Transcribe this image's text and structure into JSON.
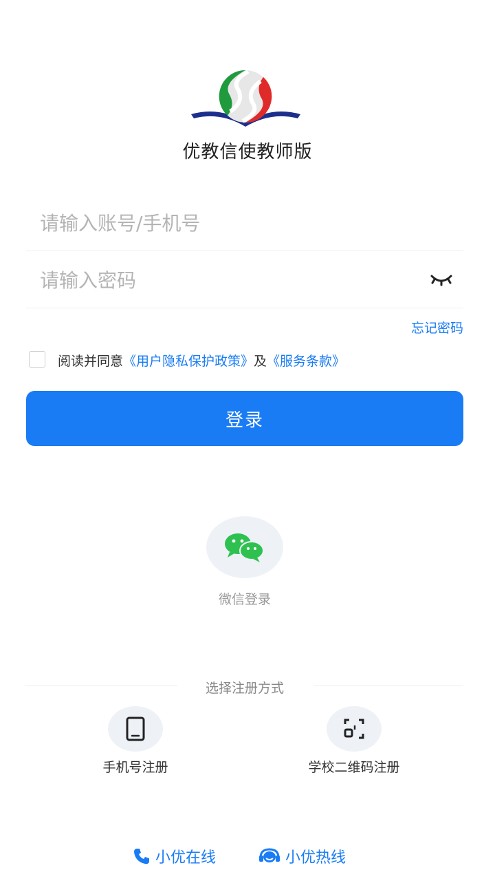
{
  "app": {
    "title": "优教信使教师版"
  },
  "login": {
    "account_placeholder": "请输入账号/手机号",
    "password_placeholder": "请输入密码",
    "forgot_password": "忘记密码",
    "agree_prefix": "阅读并同意",
    "privacy_link": "《用户隐私保护政策》",
    "agree_and": "及",
    "terms_link": "《服务条款》",
    "submit_label": "登录",
    "agreement_checked": false
  },
  "wechat": {
    "label": "微信登录"
  },
  "register": {
    "divider_text": "选择注册方式",
    "options": [
      {
        "label": "手机号注册",
        "icon": "phone-icon"
      },
      {
        "label": "学校二维码注册",
        "icon": "qr-scan-icon"
      }
    ]
  },
  "footer": {
    "online_label": "小优在线",
    "hotline_label": "小优热线"
  },
  "colors": {
    "accent": "#1a7cf5",
    "wechat_green": "#2fc150"
  }
}
